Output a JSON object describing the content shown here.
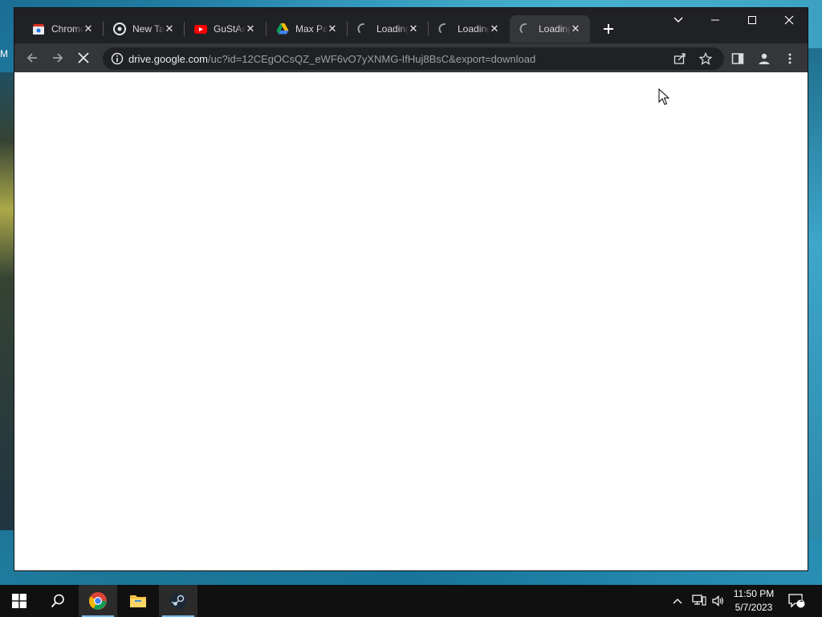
{
  "desktop": {
    "corner_text": "M"
  },
  "browser": {
    "tabs": [
      {
        "title": "Chrome",
        "icon": "chrome-web-store-icon",
        "active": false
      },
      {
        "title": "New Tab",
        "icon": "chrome-icon",
        "active": false
      },
      {
        "title": "GuStAs",
        "icon": "youtube-icon",
        "active": false
      },
      {
        "title": "Max Pa",
        "icon": "google-drive-icon",
        "active": false
      },
      {
        "title": "Loading",
        "icon": "loading-spinner-icon",
        "active": false
      },
      {
        "title": "Loading",
        "icon": "loading-spinner-icon",
        "active": false
      },
      {
        "title": "Loading",
        "icon": "loading-spinner-icon",
        "active": true
      }
    ],
    "address": {
      "host": "drive.google.com",
      "path": "/uc?id=12CEgOCsQZ_eWF6vO7yXNMG-IfHuj8BsC&export=download"
    }
  },
  "taskbar": {
    "time": "11:50 PM",
    "date": "5/7/2023",
    "notification_count": "1"
  },
  "colors": {
    "tabstrip": "#202124",
    "toolbar": "#35363a",
    "taskbar": "#101010",
    "youtube_red": "#ff0000"
  }
}
